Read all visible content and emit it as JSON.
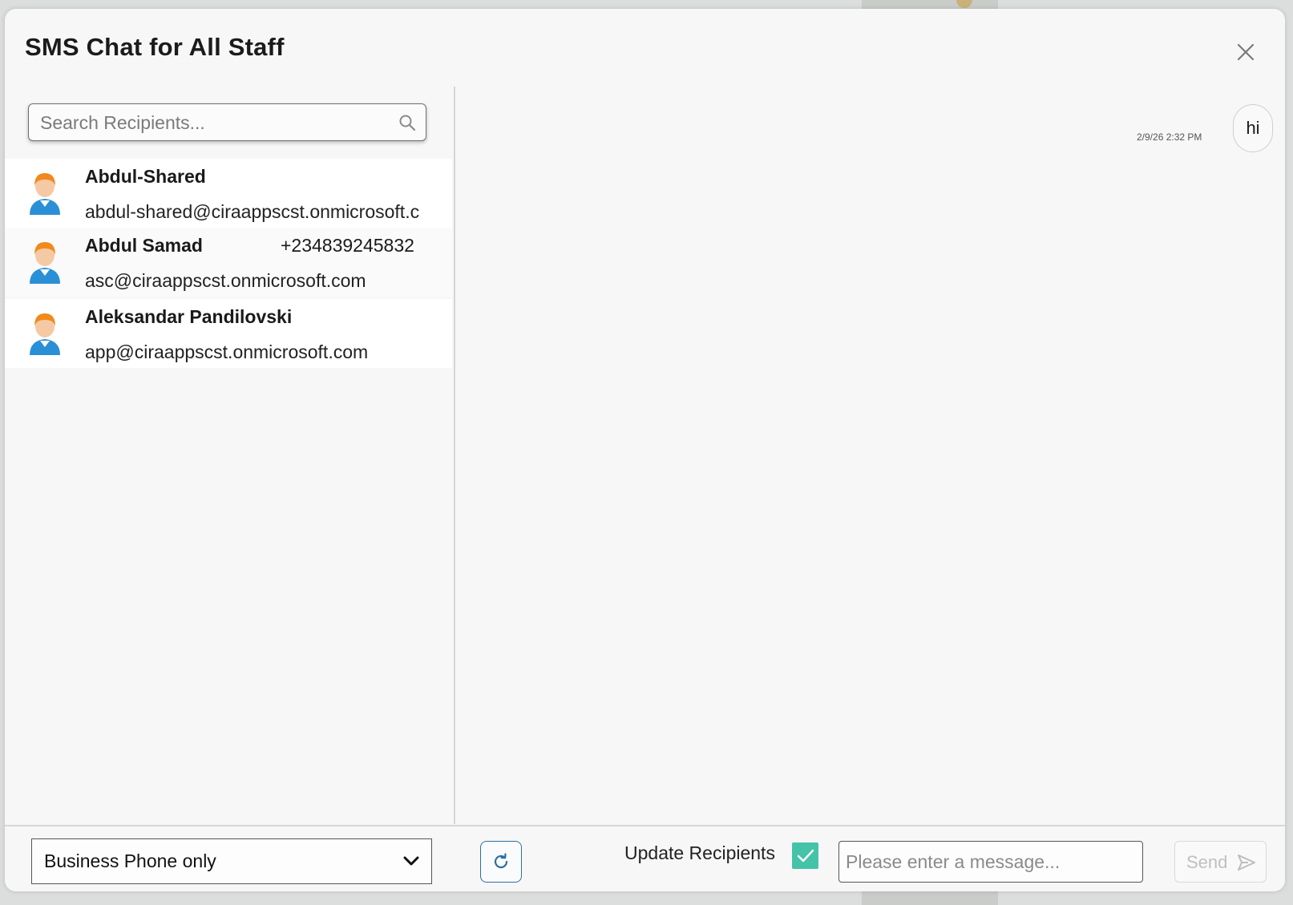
{
  "dialog": {
    "title": "SMS Chat for All Staff",
    "close_icon": "close-icon"
  },
  "search": {
    "placeholder": "Search Recipients...",
    "icon": "search-icon"
  },
  "recipients": [
    {
      "name": "Abdul-Shared",
      "phone": "",
      "email": "abdul-shared@ciraappscst.onmicrosoft.c"
    },
    {
      "name": "Abdul Samad",
      "phone": "+234839245832",
      "email": "asc@ciraappscst.onmicrosoft.com"
    },
    {
      "name": "Aleksandar Pandilovski",
      "phone": "",
      "email": "app@ciraappscst.onmicrosoft.com"
    }
  ],
  "messages": [
    {
      "text": "hi",
      "timestamp": "2/9/26 2:32 PM"
    }
  ],
  "footer": {
    "phone_filter": {
      "selected": "Business Phone only"
    },
    "refresh_icon": "refresh-icon",
    "update_recipients_label": "Update Recipients",
    "update_recipients_checked": true,
    "message_placeholder": "Please enter a message...",
    "send_label": "Send",
    "send_icon": "send-icon"
  },
  "colors": {
    "check_accent": "#45c3a8",
    "refresh_border": "#2f6f9f",
    "avatar_hair": "#f08a1c",
    "avatar_shirt": "#2b8fd6"
  }
}
